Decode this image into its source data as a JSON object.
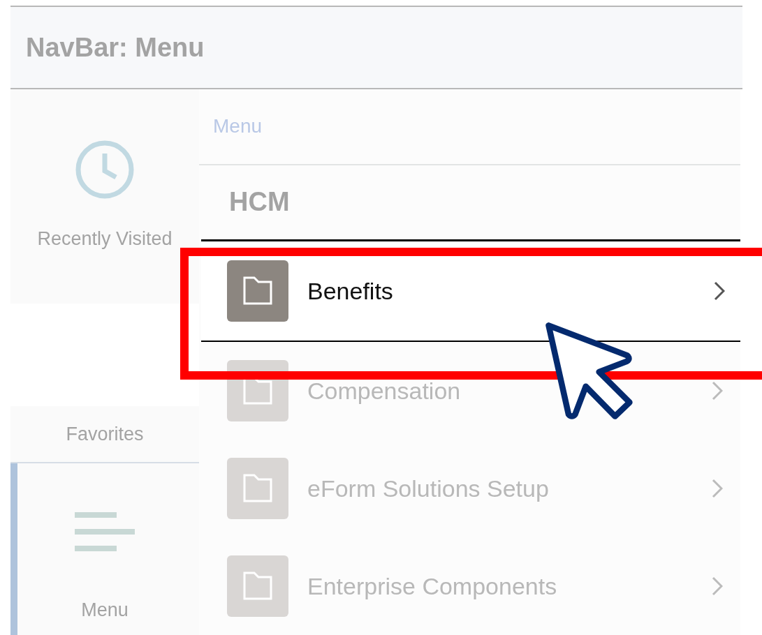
{
  "header": {
    "title": "NavBar: Menu"
  },
  "nav_tiles": [
    {
      "kind": "clock",
      "label": "Recently Visited",
      "selected": false
    },
    {
      "kind": "plain",
      "label": "Favorites",
      "selected": false
    },
    {
      "kind": "menu",
      "label": "Menu",
      "selected": true
    }
  ],
  "menu": {
    "breadcrumb": "Menu",
    "section": "HCM",
    "items": [
      {
        "label": "Benefits",
        "selected": true
      },
      {
        "label": "Compensation",
        "selected": false
      },
      {
        "label": "eForm Solutions Setup",
        "selected": false
      },
      {
        "label": "Enterprise Components",
        "selected": false
      }
    ]
  }
}
